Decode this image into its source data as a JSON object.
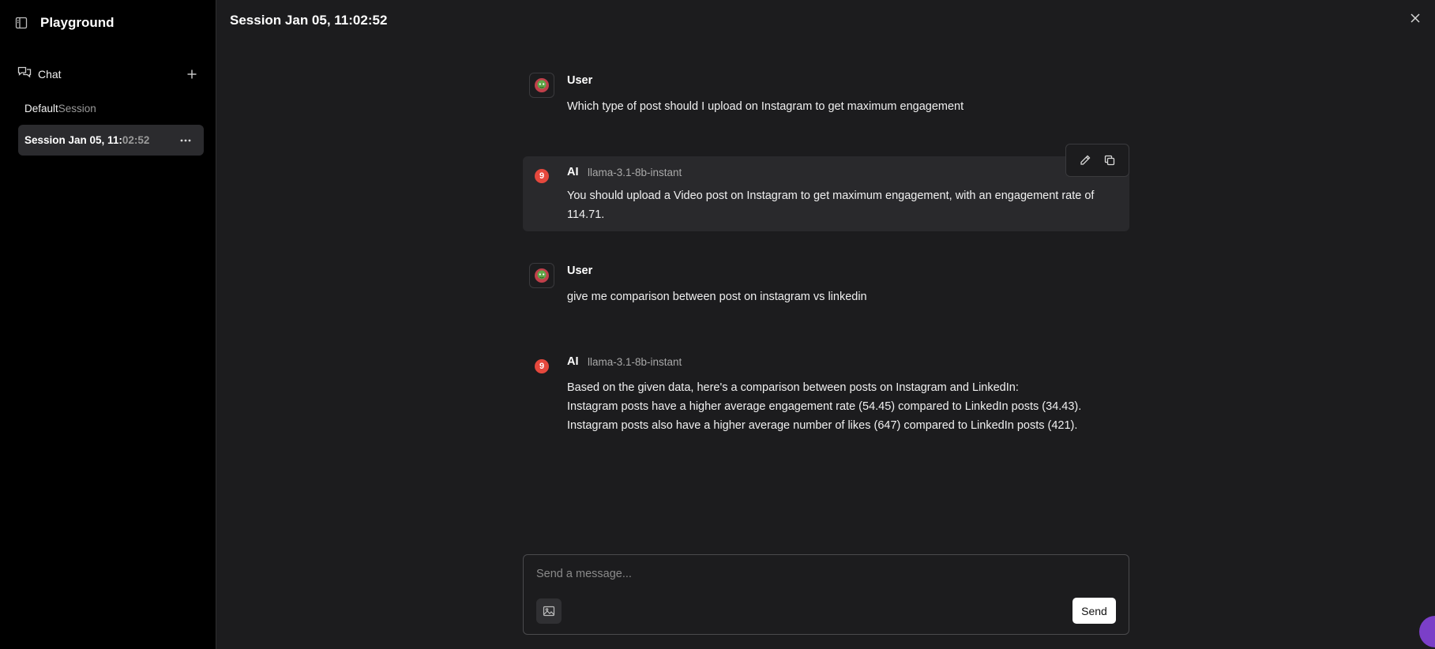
{
  "sidebar": {
    "title": "Playground",
    "chat_label": "Chat",
    "sessions": [
      {
        "head": "Default",
        "tail": " Session"
      },
      {
        "head": "Session Jan 05, 11:",
        "tail": "02:52"
      }
    ]
  },
  "main": {
    "title": "Session Jan 05, 11:02:52"
  },
  "messages": [
    {
      "role": "User",
      "text": "Which type of post should I upload on Instagram to get maximum engagement"
    },
    {
      "role": "AI",
      "model": "llama-3.1-8b-instant",
      "badge": "9",
      "text": "You should upload a Video post on Instagram to get maximum engagement, with an engagement rate of 114.71."
    },
    {
      "role": "User",
      "text": "give me comparison between post on instagram vs linkedin"
    },
    {
      "role": "AI",
      "model": "llama-3.1-8b-instant",
      "badge": "9",
      "lines": [
        "Based on the given data, here's a comparison between posts on Instagram and LinkedIn:",
        "Instagram posts have a higher average engagement rate (54.45) compared to LinkedIn posts (34.43).",
        "Instagram posts also have a higher average number of likes (647) compared to LinkedIn posts (421)."
      ]
    }
  ],
  "composer": {
    "placeholder": "Send a message...",
    "send_label": "Send"
  },
  "colors": {
    "sidebar_bg": "#000000",
    "main_bg": "#1c1c1e",
    "active_session_bg": "#2b2b2e",
    "ai_badge": "#e5483d",
    "help_fab": "#7b3fc8"
  },
  "icons": [
    "sidebar-toggle-icon",
    "chat-icon",
    "plus-icon",
    "more-icon",
    "close-icon",
    "user-avatar-icon",
    "ai-badge-icon",
    "edit-icon",
    "copy-icon",
    "image-upload-icon",
    "help-chat-icon"
  ]
}
